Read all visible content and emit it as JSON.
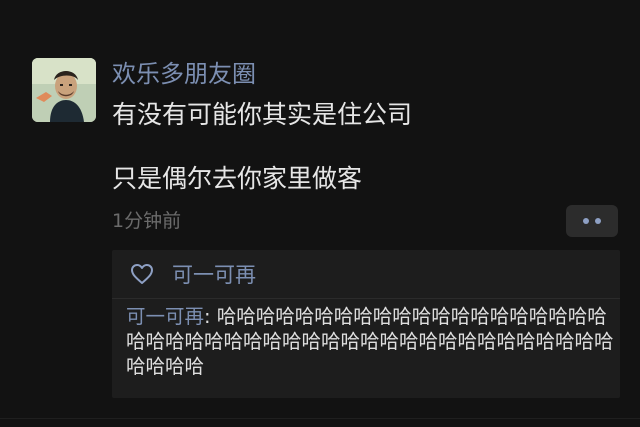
{
  "post": {
    "author": "欢乐多朋友圈",
    "text_line1": "有没有可能你其实是住公司",
    "text_line2": "只是偶尔去你家里做客",
    "time": "1分钟前"
  },
  "likes": {
    "icon": "heart-outline-icon",
    "names": "可一可再"
  },
  "comment": {
    "author": "可一可再",
    "separator": ": ",
    "text": "哈哈哈哈哈哈哈哈哈哈哈哈哈哈哈哈哈哈哈哈哈哈哈哈哈哈哈哈哈哈哈哈哈哈哈哈哈哈哈哈哈哈哈哈哈哈哈哈哈"
  },
  "colors": {
    "background": "#121212",
    "link_blue": "#7c8fb2",
    "text": "#e6e6e6",
    "muted": "#6b6b6b",
    "panel": "#1d1d1d"
  }
}
